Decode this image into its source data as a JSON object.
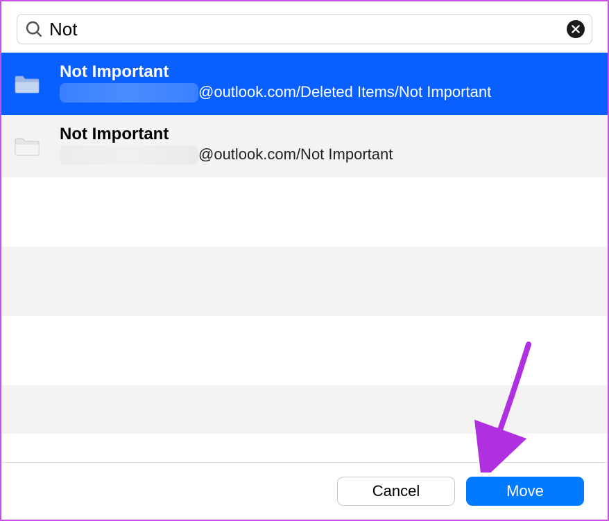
{
  "search": {
    "value": "Not ",
    "placeholder": ""
  },
  "results": [
    {
      "title": "Not Important",
      "path_suffix": "@outlook.com/Deleted Items/Not Important",
      "selected": true
    },
    {
      "title": "Not Important",
      "path_suffix": "@outlook.com/Not Important",
      "selected": false
    }
  ],
  "buttons": {
    "cancel": "Cancel",
    "move": "Move"
  },
  "colors": {
    "selection": "#0a60ff",
    "primary_button": "#007aff",
    "annotation_arrow": "#b030e0"
  }
}
